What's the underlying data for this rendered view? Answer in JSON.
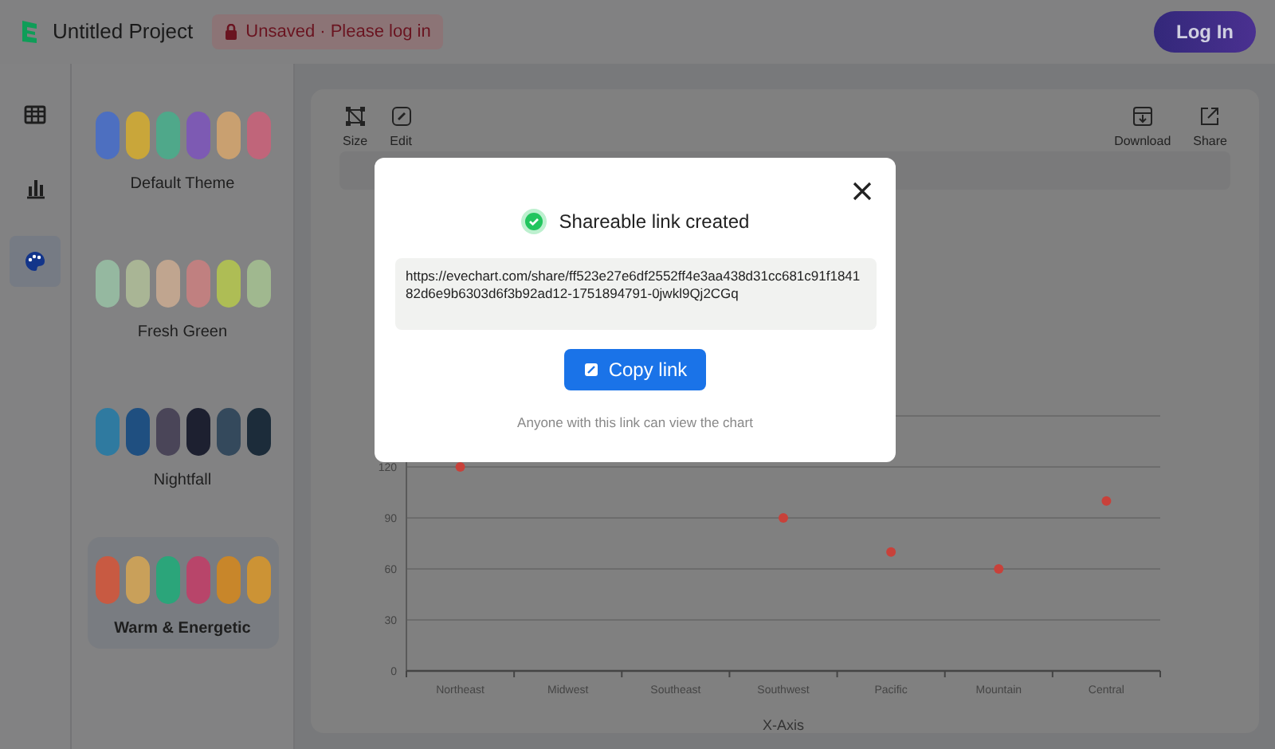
{
  "header": {
    "project_title": "Untitled Project",
    "status_badge": "Unsaved · Please log in",
    "login_button": "Log In"
  },
  "rail": [
    {
      "kind": "table",
      "selected": false
    },
    {
      "kind": "chart",
      "selected": false
    },
    {
      "kind": "palette",
      "selected": true
    }
  ],
  "themes": [
    {
      "name": "Default Theme",
      "selected": false,
      "swatches": [
        {
          "color": "#4d6fc0"
        },
        {
          "color": "#c9a63a"
        },
        {
          "color": "#4fa88a"
        },
        {
          "color": "#7d5ab3"
        },
        {
          "color": "#c9a070"
        },
        {
          "color": "#c0657a"
        }
      ]
    },
    {
      "name": "Fresh Green",
      "selected": false,
      "swatches": [
        {
          "color": "#95b8a0"
        },
        {
          "color": "#a9b595"
        },
        {
          "color": "#c0a58f"
        },
        {
          "color": "#c08080"
        },
        {
          "color": "#aebd55"
        },
        {
          "color": "#a0b88f"
        }
      ]
    },
    {
      "name": "Nightfall",
      "selected": false,
      "swatches": [
        {
          "color": "#2f7aa0"
        },
        {
          "color": "#1f4f80"
        },
        {
          "color": "#4a4558"
        },
        {
          "color": "#1d2030"
        },
        {
          "color": "#34495c"
        },
        {
          "color": "#1c2c3a"
        }
      ]
    },
    {
      "name": "Warm & Energetic",
      "selected": true,
      "swatches": [
        {
          "color": "#c85a42"
        },
        {
          "color": "#c9a05a"
        },
        {
          "color": "#2ba57a"
        },
        {
          "color": "#b8456a"
        },
        {
          "color": "#c8862a"
        },
        {
          "color": "#cc9335"
        }
      ]
    }
  ],
  "toolbar": [
    {
      "kind": "size",
      "label": "Size"
    },
    {
      "kind": "edit",
      "label": "Edit"
    },
    {
      "kind": "download",
      "label": "Download"
    },
    {
      "kind": "share",
      "label": "Share"
    }
  ],
  "chart": {
    "chart_data": {
      "type": "scatter",
      "xlabel": "X-Axis",
      "categories": [
        "Northeast",
        "Midwest",
        "Southeast",
        "Southwest",
        "Pacific",
        "Mountain",
        "Central"
      ],
      "series": [
        {
          "color": "#c8413a",
          "values": [
            120,
            null,
            null,
            90,
            70,
            60,
            100
          ]
        }
      ],
      "yticks": [
        0,
        30,
        60,
        90,
        120
      ],
      "ylim": [
        0,
        150
      ],
      "grid": true
    }
  },
  "dialog": {
    "title": "Shareable link created",
    "link": "https://evechart.com/share/ff523e27e6df2552ff4e3aa438d31cc681c91f1841 82d6e9b6303d6f3b92ad12-1751894791-0jwkl9Qj2CGq",
    "copy_button": "Copy link",
    "note": "Anyone with this link can view the chart"
  }
}
